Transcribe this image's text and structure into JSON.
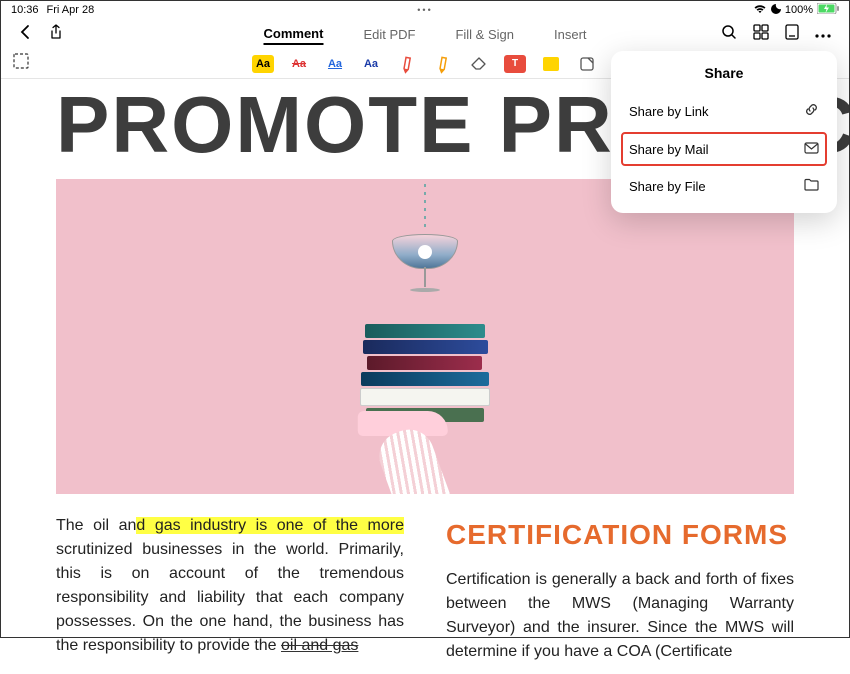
{
  "statusbar": {
    "time": "10:36",
    "date": "Fri Apr 28",
    "battery_pct": "100%"
  },
  "toolbar": {
    "tabs": {
      "comment": "Comment",
      "edit_pdf": "Edit PDF",
      "fill_sign": "Fill & Sign",
      "insert": "Insert"
    }
  },
  "subtoolbar": {
    "aa": "Aa",
    "t": "T"
  },
  "document": {
    "big_title": "PROMOTE PRODUC",
    "col_left": {
      "pre": "The oil an",
      "hl": "d gas industry is one of the more",
      "post1": " scrutinized businesses in the world. Primarily, this is on account of the tremendous responsibility and liability that each company possesses. On the one hand, the business has the responsibility to provide the ",
      "underl": "oil and gas"
    },
    "col_right": {
      "heading": "CERTIFICATION FORMS",
      "body": "Certification is generally a back and forth of fixes between the MWS (Managing Warranty Surveyor) and the insurer. Since the MWS will determine if you have a COA (Certificate"
    }
  },
  "share": {
    "title": "Share",
    "link": "Share by Link",
    "mail": "Share by Mail",
    "file": "Share by File"
  }
}
